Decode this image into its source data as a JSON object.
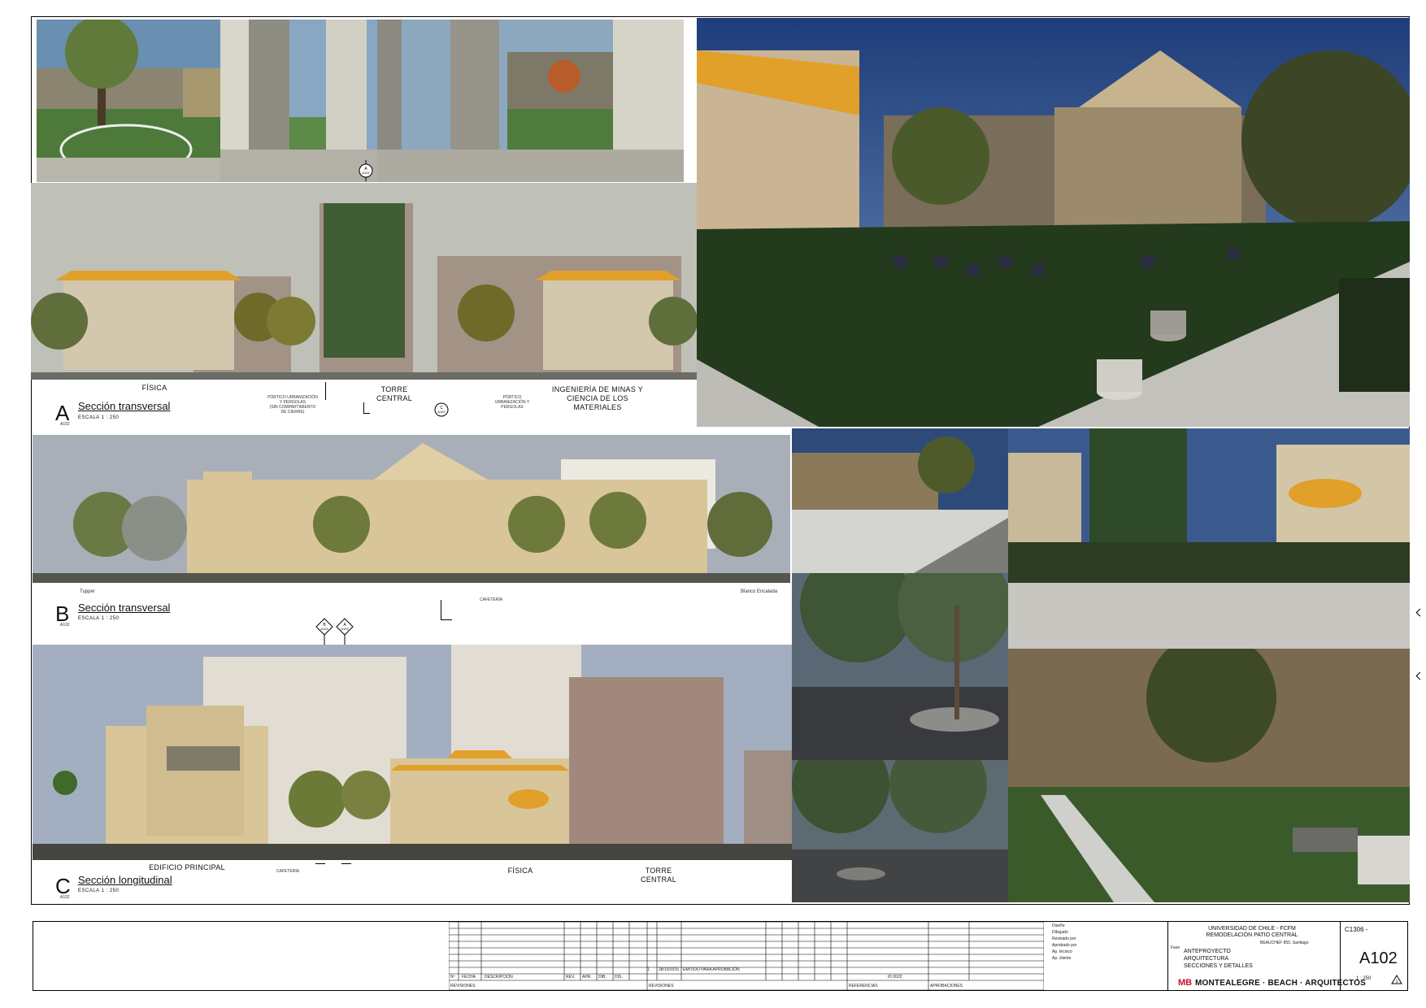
{
  "sections": {
    "a": {
      "letter": "A",
      "title": "Sección transversal",
      "scale": "ESCALA 1 : 250",
      "code": "A102",
      "labels": {
        "fisica": "FÍSICA",
        "torre": "TORRE\nCENTRAL",
        "ingenieria": "INGENIERÍA DE MINAS Y\nCIENCIA DE LOS\nMATERIALES"
      },
      "notes": {
        "portico_left": "PÓRTICO URBANIZACIÓN\nY PERGOLAS\n(SIN COMPARTIMIENTO\nDE CIERRE)",
        "portico_right": "PÓRTICO\nURBANIZACIÓN Y\nPERGOLAS"
      }
    },
    "b": {
      "letter": "B",
      "title": "Sección transversal",
      "scale": "ESCALA 1 : 250",
      "code": "A102",
      "labels": {
        "left": "Tupper",
        "right": "Blanco Encalada",
        "cafeteria": "CAFETERÍA"
      }
    },
    "c": {
      "letter": "C",
      "title": "Sección longitudinal",
      "scale": "ESCALA 1 : 250",
      "code": "A102",
      "labels": {
        "principal": "EDIFICIO PRINCIPAL",
        "fisica": "FÍSICA",
        "torre": "TORRE\nCENTRAL",
        "cafeteria": "CAFETERÍA"
      }
    }
  },
  "markers": {
    "a": "A\nA102",
    "b": "B\nA102",
    "c": "C\nA102"
  },
  "title_block": {
    "revision_row": {
      "n": "1",
      "fecha": "28/10/2015",
      "descripcion": "EMITIDO PARA APROBACIÓN"
    },
    "col_headers": {
      "n": "Nº",
      "fecha": "FECHA",
      "descripcion": "DESCRIPCIÓN",
      "rev": "REV.",
      "apr": "APR.",
      "dib": "DIB.",
      "dis": "DIS."
    },
    "section_headers": {
      "revisiones": "REVISIONES",
      "revisiones2": "REVISIONES",
      "referencias": "REFERENCIAS",
      "aprobaciones": "APROBACIONES",
      "referencias_id": "ID 0022"
    },
    "team": {
      "diseno": "Diseño",
      "dibujado": "Dibujado",
      "revisado": "Revisado por",
      "aprobado": "Aprobado por",
      "aprobado2": "Ap. técnico",
      "aprobado3": "Ap. cliente"
    },
    "client": "UNIVERSIDAD DE CHILE - FCFM",
    "project": "REMODELACIÓN PATIO CENTRAL",
    "address": "BEAUCHEF 850, Santiago",
    "phase_label": "Fase",
    "details": [
      "ANTEPROYECTO",
      "ARQUITECTURA",
      "SECCIONES Y DETALLES"
    ],
    "firm": "MONTEALEGRE · BEACH · ARQUITECTOS",
    "firm_logo": "MB",
    "project_no": "C1306 -",
    "sheet": "A102",
    "scale": "1 : 250",
    "revision_mark": "1"
  }
}
